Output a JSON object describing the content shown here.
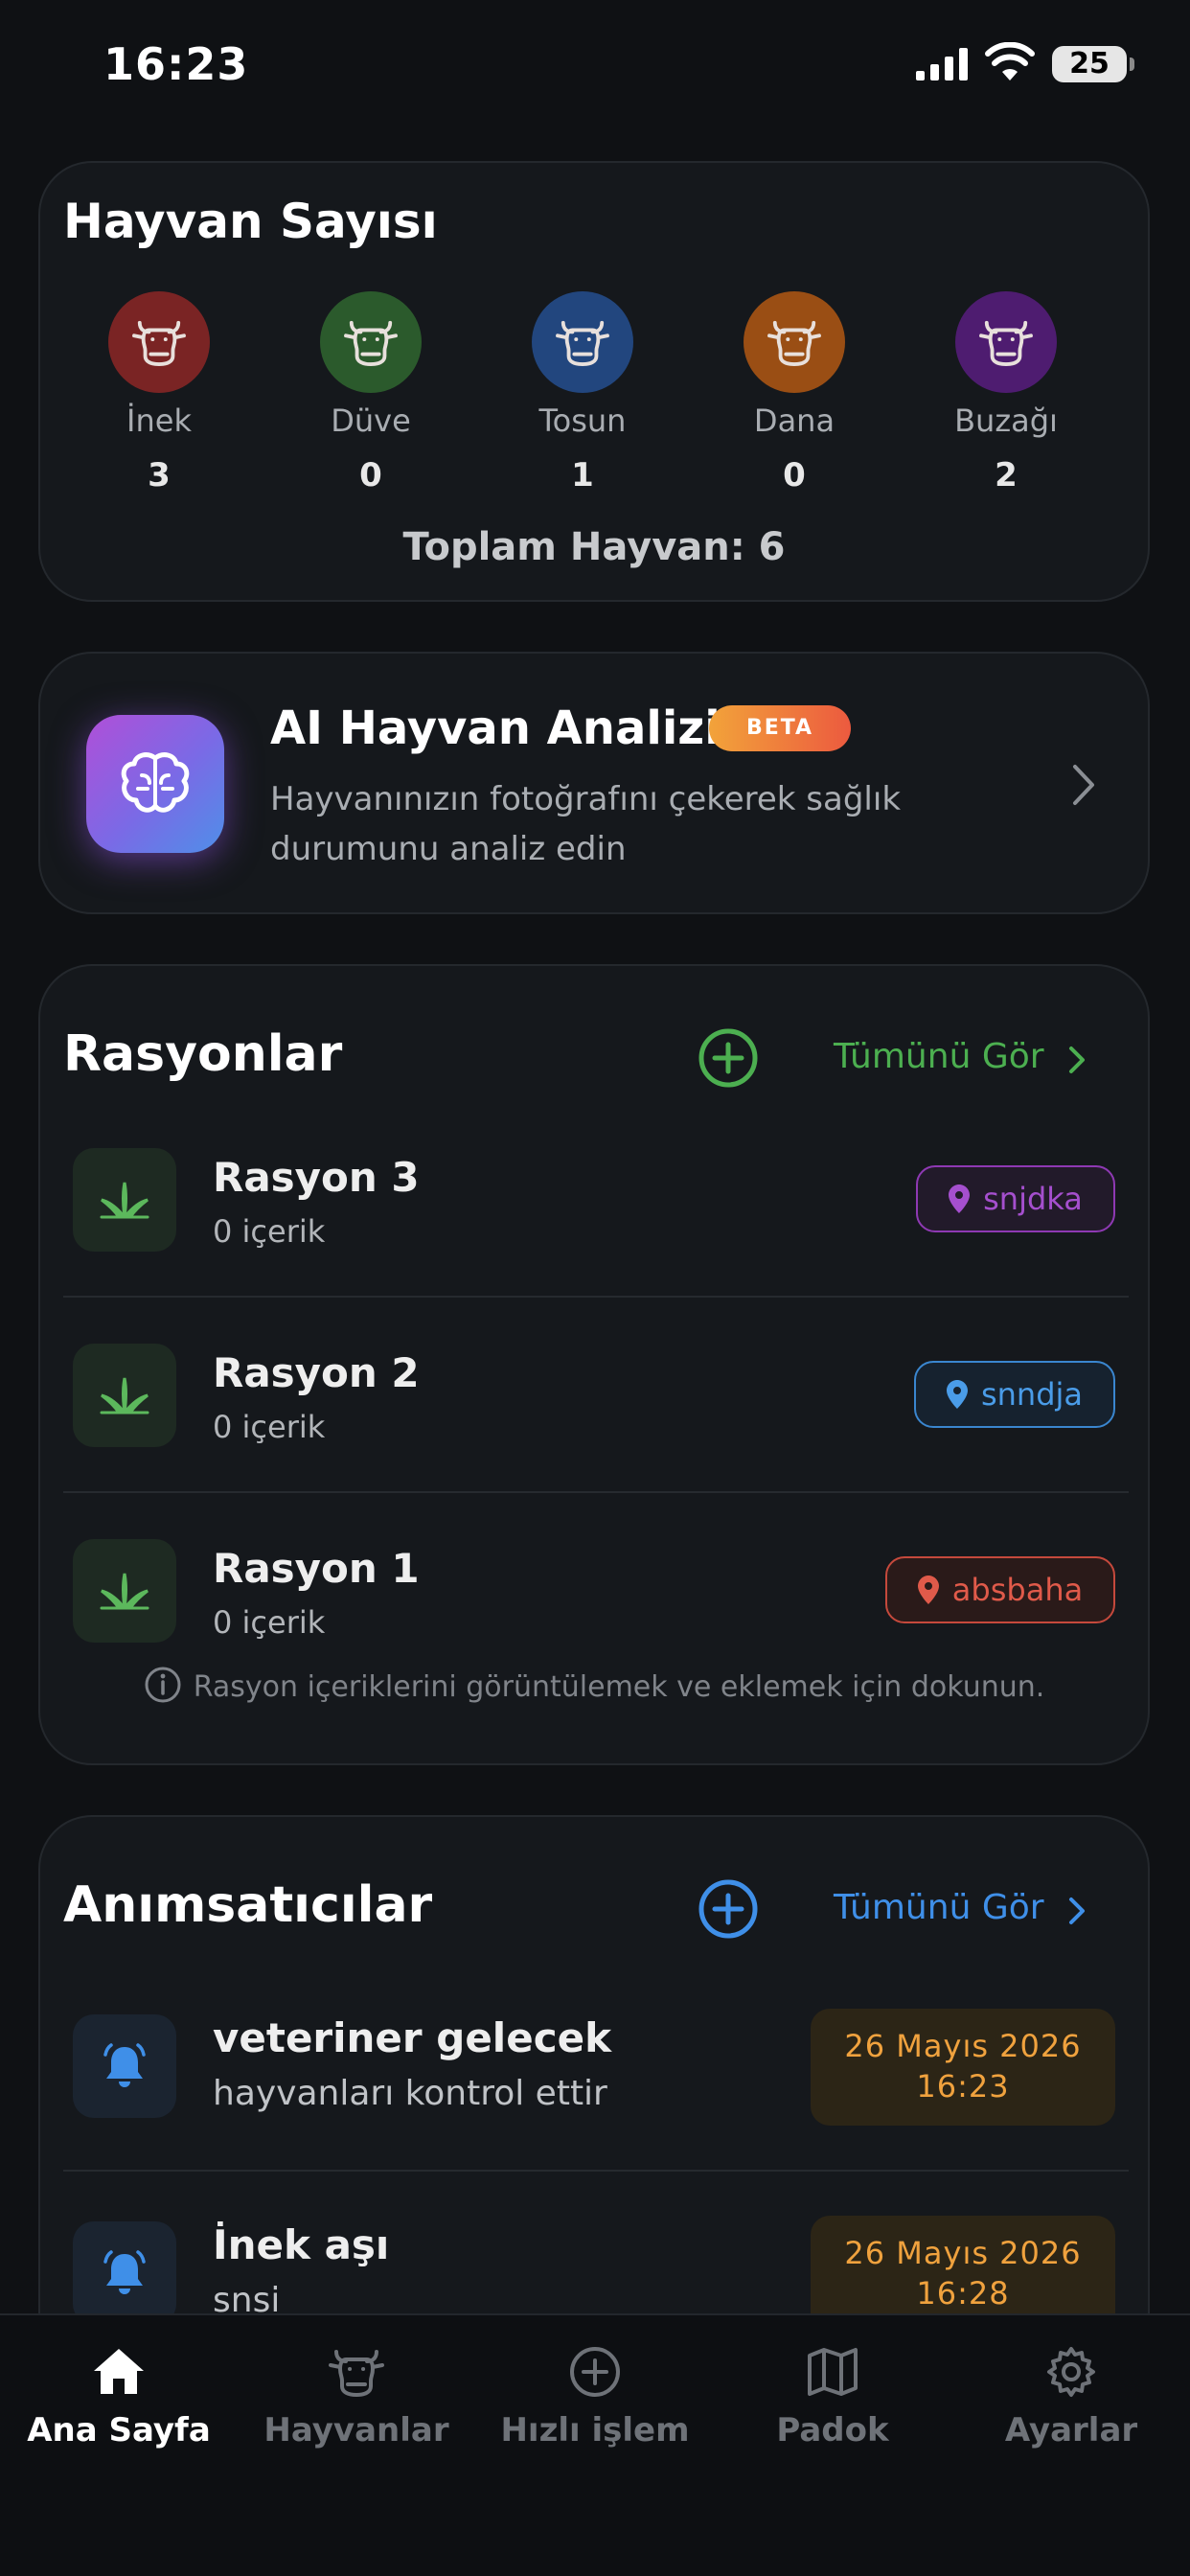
{
  "status_bar": {
    "time": "16:23",
    "battery": "25"
  },
  "animal_count": {
    "title": "Hayvan Sayısı",
    "animals": [
      {
        "name": "İnek",
        "count": "3",
        "color": "#7a2424"
      },
      {
        "name": "Düve",
        "count": "0",
        "color": "#2b5a2c"
      },
      {
        "name": "Tosun",
        "count": "1",
        "color": "#22467e"
      },
      {
        "name": "Dana",
        "count": "0",
        "color": "#9a4e14"
      },
      {
        "name": "Buzağı",
        "count": "2",
        "color": "#4e1c70"
      }
    ],
    "total": "Toplam Hayvan: 6"
  },
  "ai_card": {
    "title": "AI Hayvan Analizi",
    "badge": "BETA",
    "description": "Hayvanınızın fotoğrafını çekerek sağlık durumunu analiz edin"
  },
  "rations": {
    "title": "Rasyonlar",
    "see_all": "Tümünü Gör",
    "accent": "#4caf50",
    "items": [
      {
        "name": "Rasyon 3",
        "sub": "0 içerik",
        "tag": "snjdka",
        "tag_color": "#9b3fc0"
      },
      {
        "name": "Rasyon 2",
        "sub": "0 içerik",
        "tag": "snndja",
        "tag_color": "#3f92e0"
      },
      {
        "name": "Rasyon 1",
        "sub": "0 içerik",
        "tag": "absbaha",
        "tag_color": "#e05a4a"
      }
    ],
    "hint": "Rasyon içeriklerini görüntülemek ve eklemek için dokunun."
  },
  "reminders": {
    "title": "Anımsatıcılar",
    "see_all": "Tümünü Gör",
    "accent": "#3f8fe8",
    "items": [
      {
        "title": "veteriner gelecek",
        "sub": "hayvanları kontrol ettir",
        "date": "26 Mayıs 2026",
        "time": "16:23"
      },
      {
        "title": "İnek aşı",
        "sub": "snsi",
        "date": "26 Mayıs 2026",
        "time": "16:28"
      }
    ]
  },
  "tabbar": {
    "tabs": [
      {
        "label": "Ana Sayfa",
        "icon": "home-icon",
        "active": true
      },
      {
        "label": "Hayvanlar",
        "icon": "cow-icon"
      },
      {
        "label": "Hızlı işlem",
        "icon": "plus-circle-icon"
      },
      {
        "label": "Padok",
        "icon": "map-icon"
      },
      {
        "label": "Ayarlar",
        "icon": "gear-icon"
      }
    ]
  }
}
